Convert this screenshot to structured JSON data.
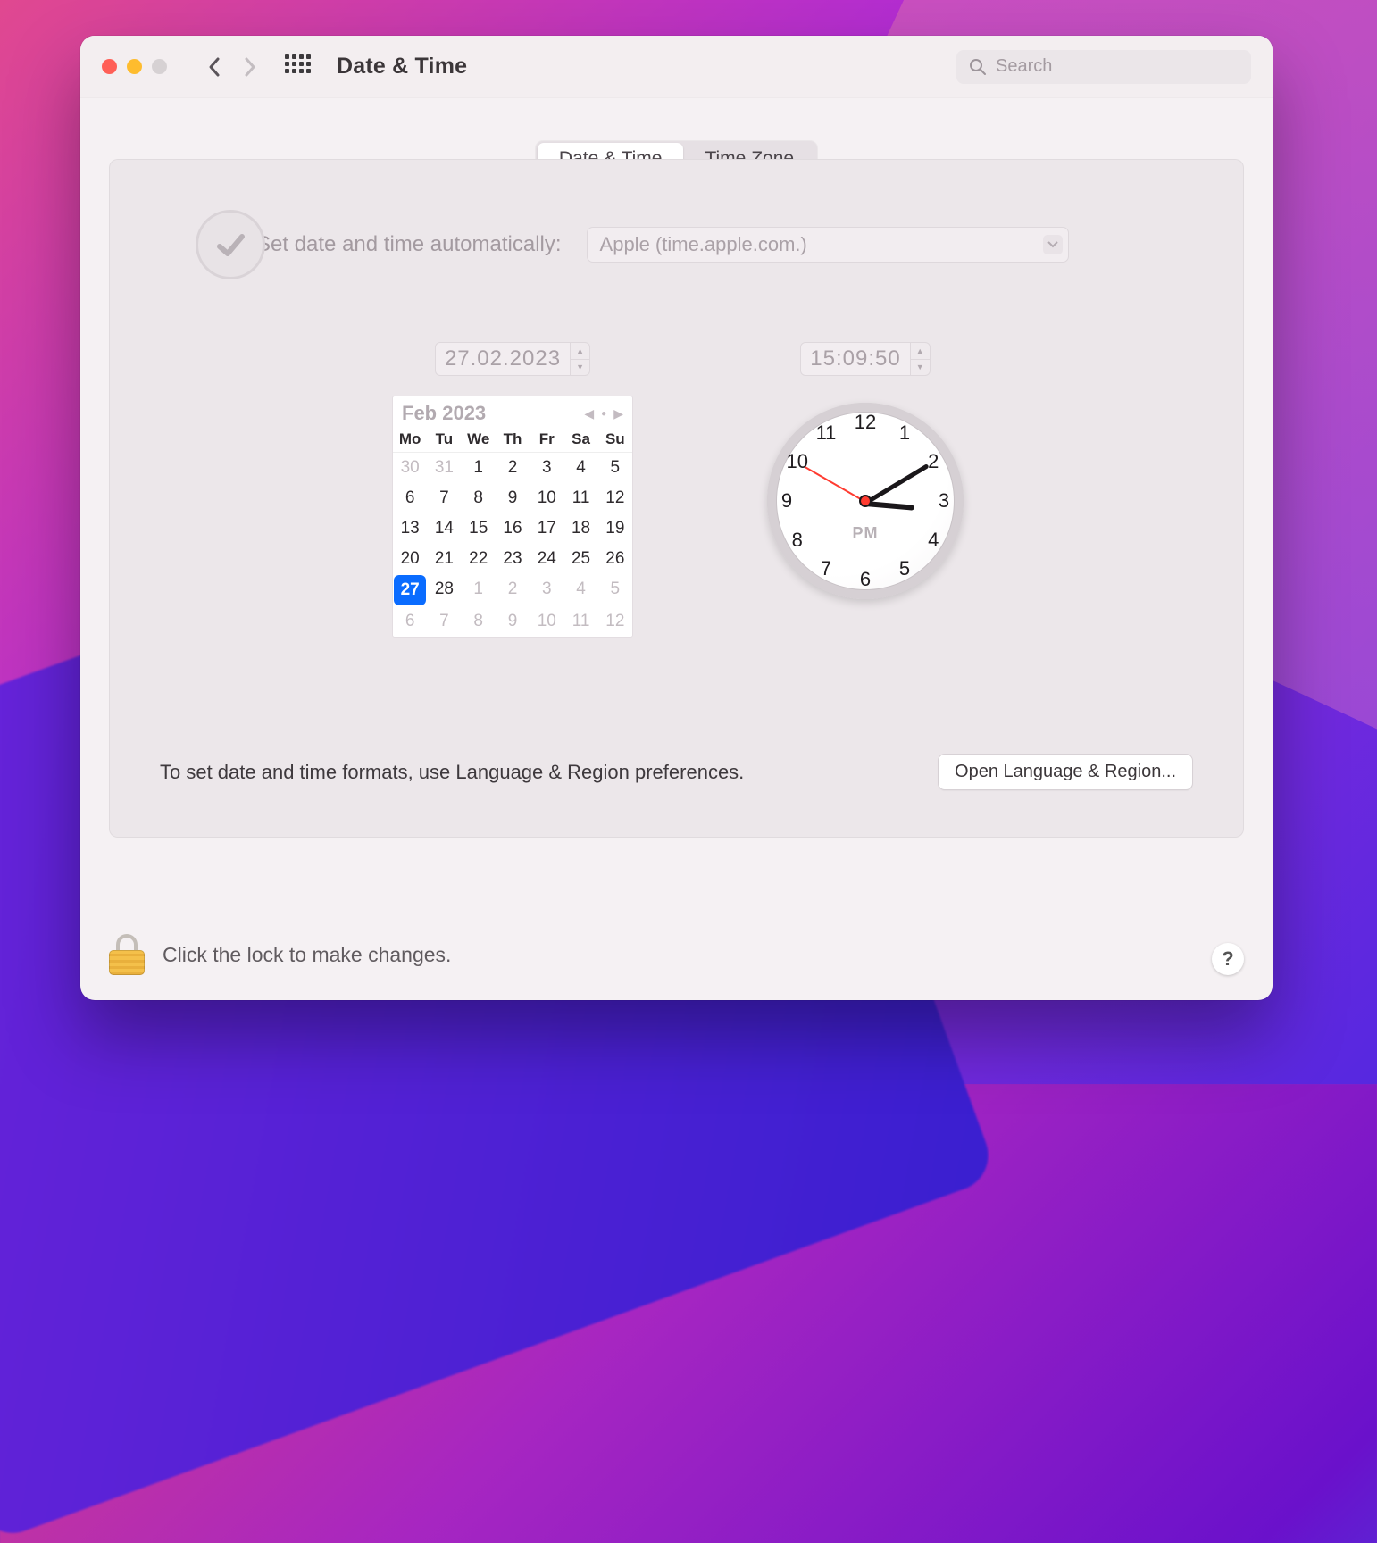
{
  "window": {
    "title": "Date & Time"
  },
  "search": {
    "placeholder": "Search"
  },
  "tabs": {
    "date_time": "Date & Time",
    "time_zone": "Time Zone",
    "active": "date_time"
  },
  "auto": {
    "label": "Set date and time automatically:",
    "server": "Apple (time.apple.com.)",
    "checked": true
  },
  "date": {
    "value": "27.02.2023",
    "month_label": "Feb 2023",
    "dow": [
      "Mo",
      "Tu",
      "We",
      "Th",
      "Fr",
      "Sa",
      "Su"
    ],
    "days": [
      {
        "n": "30",
        "out": true
      },
      {
        "n": "31",
        "out": true
      },
      {
        "n": "1"
      },
      {
        "n": "2"
      },
      {
        "n": "3"
      },
      {
        "n": "4"
      },
      {
        "n": "5"
      },
      {
        "n": "6"
      },
      {
        "n": "7"
      },
      {
        "n": "8"
      },
      {
        "n": "9"
      },
      {
        "n": "10"
      },
      {
        "n": "11"
      },
      {
        "n": "12"
      },
      {
        "n": "13"
      },
      {
        "n": "14"
      },
      {
        "n": "15"
      },
      {
        "n": "16"
      },
      {
        "n": "17"
      },
      {
        "n": "18"
      },
      {
        "n": "19"
      },
      {
        "n": "20"
      },
      {
        "n": "21"
      },
      {
        "n": "22"
      },
      {
        "n": "23"
      },
      {
        "n": "24"
      },
      {
        "n": "25"
      },
      {
        "n": "26"
      },
      {
        "n": "27",
        "sel": true
      },
      {
        "n": "28"
      },
      {
        "n": "1",
        "out": true
      },
      {
        "n": "2",
        "out": true
      },
      {
        "n": "3",
        "out": true
      },
      {
        "n": "4",
        "out": true
      },
      {
        "n": "5",
        "out": true
      },
      {
        "n": "6",
        "out": true
      },
      {
        "n": "7",
        "out": true
      },
      {
        "n": "8",
        "out": true
      },
      {
        "n": "9",
        "out": true
      },
      {
        "n": "10",
        "out": true
      },
      {
        "n": "11",
        "out": true
      },
      {
        "n": "12",
        "out": true
      }
    ]
  },
  "time": {
    "value": "15:09:50",
    "ampm": "PM",
    "hour_angle": 3.5,
    "minute_angle": -36,
    "second_angle": 210
  },
  "clock_numbers": [
    "12",
    "1",
    "2",
    "3",
    "4",
    "5",
    "6",
    "7",
    "8",
    "9",
    "10",
    "11"
  ],
  "footer": {
    "note": "To set date and time formats, use Language & Region preferences.",
    "button": "Open Language & Region..."
  },
  "lock": {
    "text": "Click the lock to make changes."
  },
  "help": "?"
}
